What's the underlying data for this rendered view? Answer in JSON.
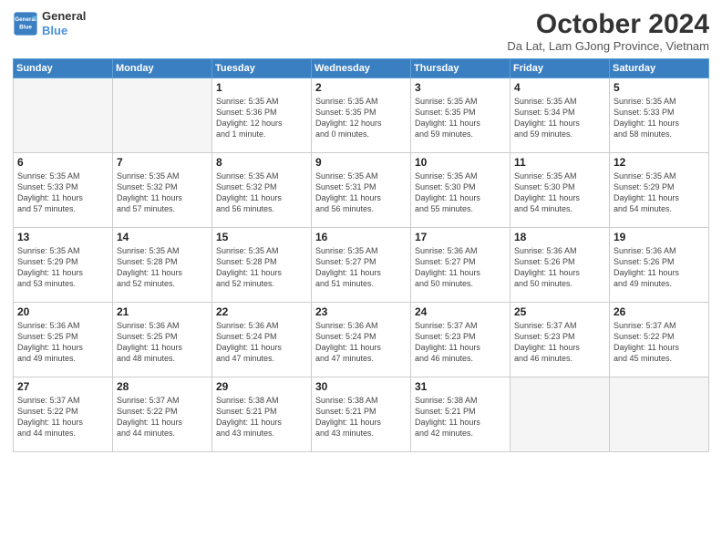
{
  "logo": {
    "line1": "General",
    "line2": "Blue"
  },
  "title": "October 2024",
  "subtitle": "Da Lat, Lam GJong Province, Vietnam",
  "weekdays": [
    "Sunday",
    "Monday",
    "Tuesday",
    "Wednesday",
    "Thursday",
    "Friday",
    "Saturday"
  ],
  "weeks": [
    [
      {
        "day": "",
        "info": ""
      },
      {
        "day": "",
        "info": ""
      },
      {
        "day": "1",
        "info": "Sunrise: 5:35 AM\nSunset: 5:36 PM\nDaylight: 12 hours\nand 1 minute."
      },
      {
        "day": "2",
        "info": "Sunrise: 5:35 AM\nSunset: 5:35 PM\nDaylight: 12 hours\nand 0 minutes."
      },
      {
        "day": "3",
        "info": "Sunrise: 5:35 AM\nSunset: 5:35 PM\nDaylight: 11 hours\nand 59 minutes."
      },
      {
        "day": "4",
        "info": "Sunrise: 5:35 AM\nSunset: 5:34 PM\nDaylight: 11 hours\nand 59 minutes."
      },
      {
        "day": "5",
        "info": "Sunrise: 5:35 AM\nSunset: 5:33 PM\nDaylight: 11 hours\nand 58 minutes."
      }
    ],
    [
      {
        "day": "6",
        "info": "Sunrise: 5:35 AM\nSunset: 5:33 PM\nDaylight: 11 hours\nand 57 minutes."
      },
      {
        "day": "7",
        "info": "Sunrise: 5:35 AM\nSunset: 5:32 PM\nDaylight: 11 hours\nand 57 minutes."
      },
      {
        "day": "8",
        "info": "Sunrise: 5:35 AM\nSunset: 5:32 PM\nDaylight: 11 hours\nand 56 minutes."
      },
      {
        "day": "9",
        "info": "Sunrise: 5:35 AM\nSunset: 5:31 PM\nDaylight: 11 hours\nand 56 minutes."
      },
      {
        "day": "10",
        "info": "Sunrise: 5:35 AM\nSunset: 5:30 PM\nDaylight: 11 hours\nand 55 minutes."
      },
      {
        "day": "11",
        "info": "Sunrise: 5:35 AM\nSunset: 5:30 PM\nDaylight: 11 hours\nand 54 minutes."
      },
      {
        "day": "12",
        "info": "Sunrise: 5:35 AM\nSunset: 5:29 PM\nDaylight: 11 hours\nand 54 minutes."
      }
    ],
    [
      {
        "day": "13",
        "info": "Sunrise: 5:35 AM\nSunset: 5:29 PM\nDaylight: 11 hours\nand 53 minutes."
      },
      {
        "day": "14",
        "info": "Sunrise: 5:35 AM\nSunset: 5:28 PM\nDaylight: 11 hours\nand 52 minutes."
      },
      {
        "day": "15",
        "info": "Sunrise: 5:35 AM\nSunset: 5:28 PM\nDaylight: 11 hours\nand 52 minutes."
      },
      {
        "day": "16",
        "info": "Sunrise: 5:35 AM\nSunset: 5:27 PM\nDaylight: 11 hours\nand 51 minutes."
      },
      {
        "day": "17",
        "info": "Sunrise: 5:36 AM\nSunset: 5:27 PM\nDaylight: 11 hours\nand 50 minutes."
      },
      {
        "day": "18",
        "info": "Sunrise: 5:36 AM\nSunset: 5:26 PM\nDaylight: 11 hours\nand 50 minutes."
      },
      {
        "day": "19",
        "info": "Sunrise: 5:36 AM\nSunset: 5:26 PM\nDaylight: 11 hours\nand 49 minutes."
      }
    ],
    [
      {
        "day": "20",
        "info": "Sunrise: 5:36 AM\nSunset: 5:25 PM\nDaylight: 11 hours\nand 49 minutes."
      },
      {
        "day": "21",
        "info": "Sunrise: 5:36 AM\nSunset: 5:25 PM\nDaylight: 11 hours\nand 48 minutes."
      },
      {
        "day": "22",
        "info": "Sunrise: 5:36 AM\nSunset: 5:24 PM\nDaylight: 11 hours\nand 47 minutes."
      },
      {
        "day": "23",
        "info": "Sunrise: 5:36 AM\nSunset: 5:24 PM\nDaylight: 11 hours\nand 47 minutes."
      },
      {
        "day": "24",
        "info": "Sunrise: 5:37 AM\nSunset: 5:23 PM\nDaylight: 11 hours\nand 46 minutes."
      },
      {
        "day": "25",
        "info": "Sunrise: 5:37 AM\nSunset: 5:23 PM\nDaylight: 11 hours\nand 46 minutes."
      },
      {
        "day": "26",
        "info": "Sunrise: 5:37 AM\nSunset: 5:22 PM\nDaylight: 11 hours\nand 45 minutes."
      }
    ],
    [
      {
        "day": "27",
        "info": "Sunrise: 5:37 AM\nSunset: 5:22 PM\nDaylight: 11 hours\nand 44 minutes."
      },
      {
        "day": "28",
        "info": "Sunrise: 5:37 AM\nSunset: 5:22 PM\nDaylight: 11 hours\nand 44 minutes."
      },
      {
        "day": "29",
        "info": "Sunrise: 5:38 AM\nSunset: 5:21 PM\nDaylight: 11 hours\nand 43 minutes."
      },
      {
        "day": "30",
        "info": "Sunrise: 5:38 AM\nSunset: 5:21 PM\nDaylight: 11 hours\nand 43 minutes."
      },
      {
        "day": "31",
        "info": "Sunrise: 5:38 AM\nSunset: 5:21 PM\nDaylight: 11 hours\nand 42 minutes."
      },
      {
        "day": "",
        "info": ""
      },
      {
        "day": "",
        "info": ""
      }
    ]
  ]
}
